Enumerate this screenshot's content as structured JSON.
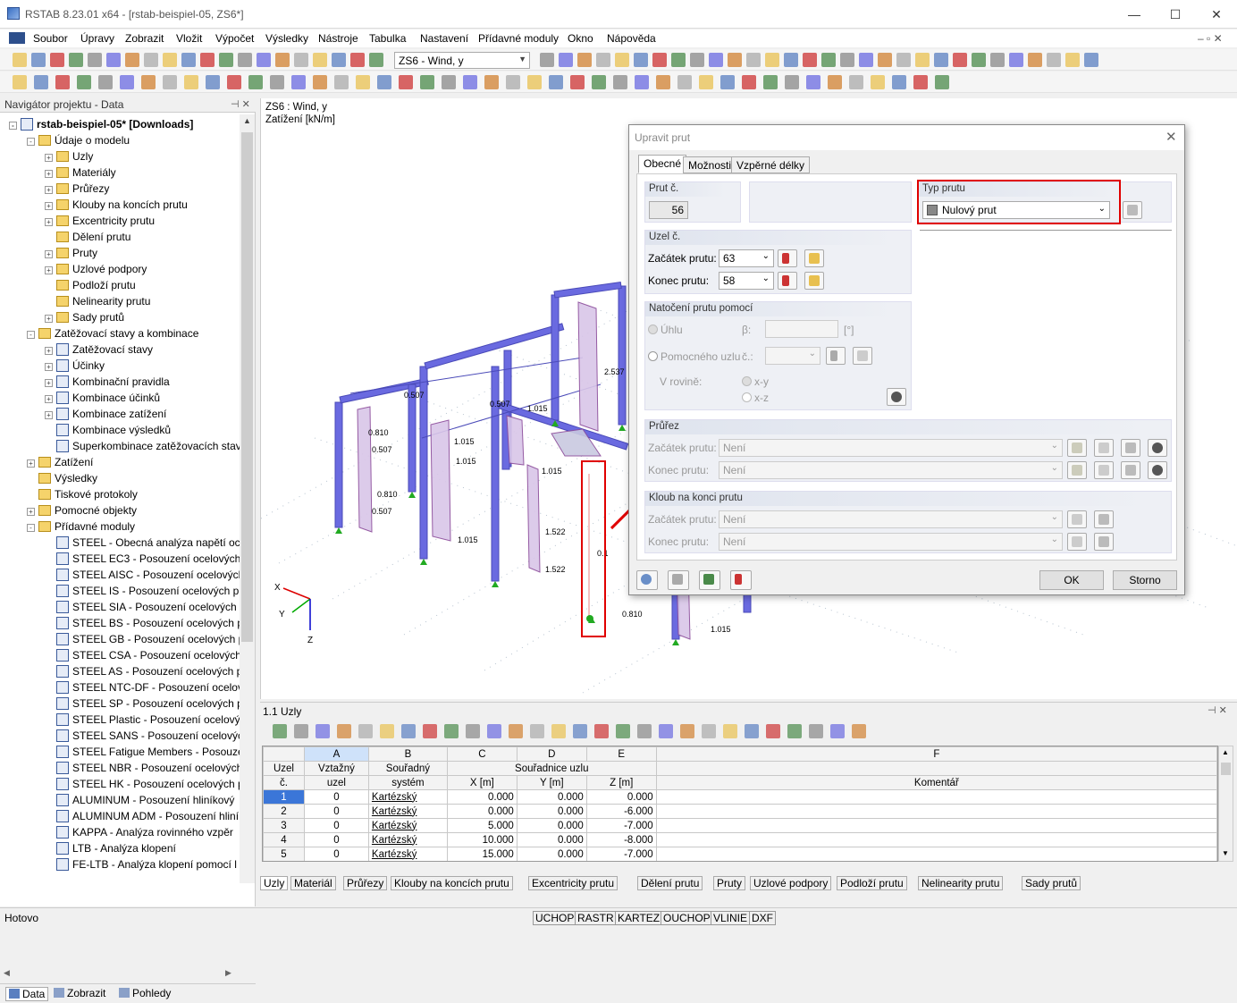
{
  "window": {
    "title": "RSTAB 8.23.01 x64 - [rstab-beispiel-05, ZS6*]",
    "minimize": "—",
    "maximize": "☐",
    "close": "✕"
  },
  "menu": [
    "Soubor",
    "Úpravy",
    "Zobrazit",
    "Vložit",
    "Výpočet",
    "Výsledky",
    "Nástroje",
    "Tabulka",
    "Nastavení",
    "Přídavné moduly",
    "Okno",
    "Nápověda"
  ],
  "toolbar": {
    "load_case": "ZS6 - Wind, y"
  },
  "navigator": {
    "title": "Navigátor projektu - Data",
    "root": "rstab-beispiel-05* [Downloads]",
    "items": [
      {
        "label": "Údaje o modelu",
        "level": 1,
        "kind": "folder",
        "exp": "-"
      },
      {
        "label": "Uzly",
        "level": 2,
        "kind": "folder",
        "exp": "+"
      },
      {
        "label": "Materiály",
        "level": 2,
        "kind": "folder",
        "exp": "+"
      },
      {
        "label": "Průřezy",
        "level": 2,
        "kind": "folder",
        "exp": "+"
      },
      {
        "label": "Klouby na koncích prutu",
        "level": 2,
        "kind": "folder",
        "exp": "+"
      },
      {
        "label": "Excentricity prutu",
        "level": 2,
        "kind": "folder",
        "exp": "+"
      },
      {
        "label": "Dělení prutu",
        "level": 2,
        "kind": "folder",
        "exp": ""
      },
      {
        "label": "Pruty",
        "level": 2,
        "kind": "folder",
        "exp": "+"
      },
      {
        "label": "Uzlové podpory",
        "level": 2,
        "kind": "folder",
        "exp": "+"
      },
      {
        "label": "Podloží prutu",
        "level": 2,
        "kind": "folder",
        "exp": ""
      },
      {
        "label": "Nelinearity prutu",
        "level": 2,
        "kind": "folder",
        "exp": ""
      },
      {
        "label": "Sady prutů",
        "level": 2,
        "kind": "folder",
        "exp": "+"
      },
      {
        "label": "Zatěžovací stavy a kombinace",
        "level": 1,
        "kind": "folder",
        "exp": "-"
      },
      {
        "label": "Zatěžovací stavy",
        "level": 2,
        "kind": "module",
        "exp": "+"
      },
      {
        "label": "Účinky",
        "level": 2,
        "kind": "module",
        "exp": "+"
      },
      {
        "label": "Kombinační pravidla",
        "level": 2,
        "kind": "module",
        "exp": "+"
      },
      {
        "label": "Kombinace účinků",
        "level": 2,
        "kind": "module",
        "exp": "+"
      },
      {
        "label": "Kombinace zatížení",
        "level": 2,
        "kind": "module",
        "exp": "+"
      },
      {
        "label": "Kombinace výsledků",
        "level": 2,
        "kind": "module",
        "exp": ""
      },
      {
        "label": "Superkombinace zatěžovacích stav",
        "level": 2,
        "kind": "module",
        "exp": ""
      },
      {
        "label": "Zatížení",
        "level": 1,
        "kind": "folder",
        "exp": "+"
      },
      {
        "label": "Výsledky",
        "level": 1,
        "kind": "folder",
        "exp": ""
      },
      {
        "label": "Tiskové protokoly",
        "level": 1,
        "kind": "folder",
        "exp": ""
      },
      {
        "label": "Pomocné objekty",
        "level": 1,
        "kind": "folder",
        "exp": "+"
      },
      {
        "label": "Přídavné moduly",
        "level": 1,
        "kind": "folder",
        "exp": "-"
      },
      {
        "label": "STEEL - Obecná analýza napětí oce",
        "level": 2,
        "kind": "module",
        "exp": ""
      },
      {
        "label": "STEEL EC3 - Posouzení ocelových",
        "level": 2,
        "kind": "module",
        "exp": ""
      },
      {
        "label": "STEEL AISC - Posouzení ocelových",
        "level": 2,
        "kind": "module",
        "exp": ""
      },
      {
        "label": "STEEL IS - Posouzení ocelových pr",
        "level": 2,
        "kind": "module",
        "exp": ""
      },
      {
        "label": "STEEL SIA - Posouzení ocelových p",
        "level": 2,
        "kind": "module",
        "exp": ""
      },
      {
        "label": "STEEL BS - Posouzení ocelových p",
        "level": 2,
        "kind": "module",
        "exp": ""
      },
      {
        "label": "STEEL GB - Posouzení ocelových p",
        "level": 2,
        "kind": "module",
        "exp": ""
      },
      {
        "label": "STEEL CSA - Posouzení ocelových",
        "level": 2,
        "kind": "module",
        "exp": ""
      },
      {
        "label": "STEEL AS - Posouzení ocelových p",
        "level": 2,
        "kind": "module",
        "exp": ""
      },
      {
        "label": "STEEL NTC-DF - Posouzení ocelov",
        "level": 2,
        "kind": "module",
        "exp": ""
      },
      {
        "label": "STEEL SP - Posouzení ocelových p",
        "level": 2,
        "kind": "module",
        "exp": ""
      },
      {
        "label": "STEEL Plastic - Posouzení ocelový",
        "level": 2,
        "kind": "module",
        "exp": ""
      },
      {
        "label": "STEEL SANS - Posouzení ocelových",
        "level": 2,
        "kind": "module",
        "exp": ""
      },
      {
        "label": "STEEL Fatigue Members - Posouze",
        "level": 2,
        "kind": "module",
        "exp": ""
      },
      {
        "label": "STEEL NBR - Posouzení ocelových",
        "level": 2,
        "kind": "module",
        "exp": ""
      },
      {
        "label": "STEEL HK - Posouzení ocelových p",
        "level": 2,
        "kind": "module",
        "exp": ""
      },
      {
        "label": "ALUMINUM - Posouzení hliníkový",
        "level": 2,
        "kind": "module",
        "exp": ""
      },
      {
        "label": "ALUMINUM ADM - Posouzení hliní",
        "level": 2,
        "kind": "module",
        "exp": ""
      },
      {
        "label": "KAPPA - Analýza rovinného vzpěr",
        "level": 2,
        "kind": "module",
        "exp": ""
      },
      {
        "label": "LTB - Analýza klopení",
        "level": 2,
        "kind": "module",
        "exp": ""
      },
      {
        "label": "FE-LTB - Analýza klopení pomocí l",
        "level": 2,
        "kind": "module",
        "exp": ""
      }
    ],
    "tabs": [
      "Data",
      "Zobrazit",
      "Pohledy"
    ]
  },
  "view": {
    "lc_line1": "ZS6 : Wind, y",
    "lc_line2": "Zatížení [kN/m]",
    "values": [
      "0.507",
      "0.810",
      "0.507",
      "0.810",
      "0.507",
      "1.015",
      "1.015",
      "1.015",
      "1.522",
      "1.522",
      "1.015",
      "0.507",
      "2.537",
      "1.015",
      "0.810",
      "0.1",
      "1.015"
    ],
    "axes": {
      "x": "X",
      "y": "Y",
      "z": "Z"
    }
  },
  "dialog": {
    "title": "Upravit prut",
    "tabs": [
      "Obecné",
      "Možnosti",
      "Vzpěrné délky"
    ],
    "prut_label": "Prut č.",
    "prut_no": "56",
    "typ_label": "Typ prutu",
    "typ_value": "Nulový prut",
    "uzel_label": "Uzel č.",
    "zacatek_label": "Začátek prutu:",
    "zacatek_value": "63",
    "konec_label": "Konec prutu:",
    "konec_value": "58",
    "natoceni_label": "Natočení prutu pomocí",
    "uhlu_label": "Úhlu",
    "beta_label": "β:",
    "beta_unit": "[°]",
    "pom_label": "Pomocného uzlu",
    "c_label": "č.:",
    "v_rovine_label": "V rovině:",
    "xy_label": "x-y",
    "xz_label": "x-z",
    "prurez_label": "Průřez",
    "prurez_zac_label": "Začátek prutu:",
    "prurez_zac_value": "Není",
    "prurez_kon_label": "Konec prutu:",
    "prurez_kon_value": "Není",
    "kloub_label": "Kloub na konci prutu",
    "kloub_zac_label": "Začátek prutu:",
    "kloub_zac_value": "Není",
    "kloub_kon_label": "Konec prutu:",
    "kloub_kon_value": "Není",
    "ok": "OK",
    "cancel": "Storno"
  },
  "table": {
    "panel_title": "1.1 Uzly",
    "col_letters": [
      "A",
      "B",
      "C",
      "D",
      "E",
      "F"
    ],
    "h_uzel": "Uzel",
    "h_uzel2": "č.",
    "h_vztazny": "Vztažný",
    "h_vztazny2": "uzel",
    "h_souradny": "Souřadný",
    "h_souradny2": "systém",
    "h_sour_uzlu": "Souřadnice uzlu",
    "h_x": "X [m]",
    "h_y": "Y [m]",
    "h_z": "Z [m]",
    "h_komentar": "Komentář",
    "rows": [
      {
        "no": "1",
        "ref": "0",
        "sys": "Kartézský",
        "x": "0.000",
        "y": "0.000",
        "z": "0.000"
      },
      {
        "no": "2",
        "ref": "0",
        "sys": "Kartézský",
        "x": "0.000",
        "y": "0.000",
        "z": "-6.000"
      },
      {
        "no": "3",
        "ref": "0",
        "sys": "Kartézský",
        "x": "5.000",
        "y": "0.000",
        "z": "-7.000"
      },
      {
        "no": "4",
        "ref": "0",
        "sys": "Kartézský",
        "x": "10.000",
        "y": "0.000",
        "z": "-8.000"
      },
      {
        "no": "5",
        "ref": "0",
        "sys": "Kartézský",
        "x": "15.000",
        "y": "0.000",
        "z": "-7.000"
      }
    ],
    "sheet_tabs": [
      "Uzly",
      "Materiál",
      "Průřezy",
      "Klouby na koncích prutu",
      "Excentricity prutu",
      "Dělení prutu",
      "Pruty",
      "Uzlové podpory",
      "Podloží prutu",
      "Nelinearity prutu",
      "Sady prutů"
    ]
  },
  "status": {
    "left": "Hotovo",
    "toggles": [
      "UCHOP",
      "RASTR",
      "KARTEZ",
      "OUCHOP",
      "VLINIE",
      "DXF"
    ]
  },
  "colors": {
    "accent": "#e00000",
    "member": "#6a6ae0",
    "load": "#d9b3e0",
    "support": "#22aa22"
  }
}
